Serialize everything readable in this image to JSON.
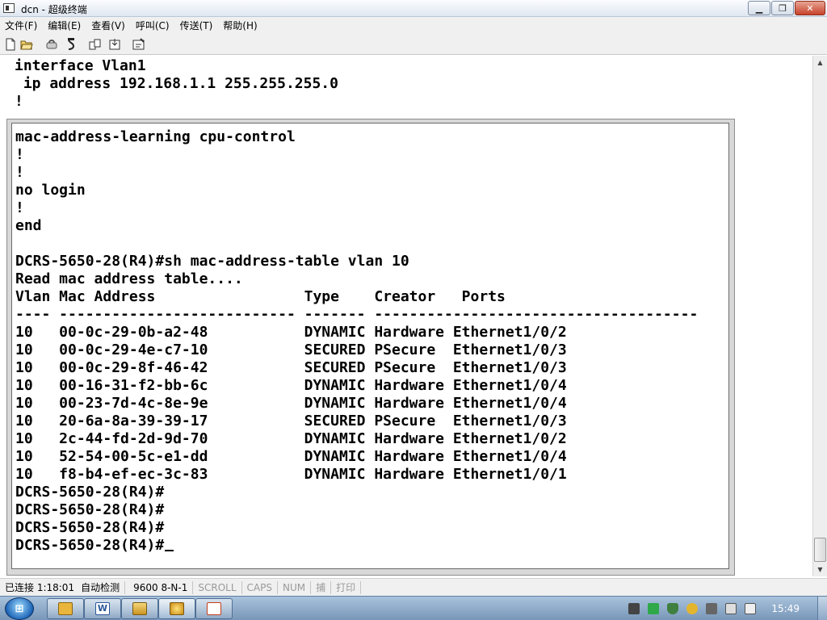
{
  "window": {
    "title": "dcn - 超级终端",
    "controls": {
      "minimize": "▁",
      "maximize": "❐",
      "close": "✕"
    }
  },
  "menu": [
    "文件(F)",
    "编辑(E)",
    "查看(V)",
    "呼叫(C)",
    "传送(T)",
    "帮助(H)"
  ],
  "toolbar": [
    "new-icon",
    "open-icon",
    "connect-icon",
    "disconnect-icon",
    "send-icon",
    "receive-icon",
    "properties-icon"
  ],
  "terminal": {
    "background_lines": [
      "interface Vlan1",
      " ip address 192.168.1.1 255.255.255.0",
      "!"
    ],
    "lines": [
      "mac-address-learning cpu-control",
      "!",
      "!",
      "no login",
      "!",
      "end",
      "",
      "DCRS-5650-28(R4)#sh mac-address-table vlan 10",
      "Read mac address table....",
      "Vlan Mac Address                 Type    Creator   Ports",
      "---- --------------------------- ------- -------------------------------------",
      "10   00-0c-29-0b-a2-48           DYNAMIC Hardware Ethernet1/0/2",
      "10   00-0c-29-4e-c7-10           SECURED PSecure  Ethernet1/0/3",
      "10   00-0c-29-8f-46-42           SECURED PSecure  Ethernet1/0/3",
      "10   00-16-31-f2-bb-6c           DYNAMIC Hardware Ethernet1/0/4",
      "10   00-23-7d-4c-8e-9e           DYNAMIC Hardware Ethernet1/0/4",
      "10   20-6a-8a-39-39-17           SECURED PSecure  Ethernet1/0/3",
      "10   2c-44-fd-2d-9d-70           DYNAMIC Hardware Ethernet1/0/2",
      "10   52-54-00-5c-e1-dd           DYNAMIC Hardware Ethernet1/0/4",
      "10   f8-b4-ef-ec-3c-83           DYNAMIC Hardware Ethernet1/0/1",
      "DCRS-5650-28(R4)#",
      "DCRS-5650-28(R4)#",
      "DCRS-5650-28(R4)#"
    ],
    "prompt": "DCRS-5650-28(R4)#"
  },
  "statusbar": {
    "connection": "已连接 1:18:01",
    "detect": "自动检测",
    "baud": "9600 8-N-1",
    "scroll": "SCROLL",
    "caps": "CAPS",
    "num": "NUM",
    "capture": "捕",
    "print": "打印"
  },
  "taskbar": {
    "clock": "15:49",
    "start_label": "⊞",
    "buttons": [
      "folder-icon",
      "word-icon",
      "explorer-icon",
      "hyperterminal-icon",
      "powerpoint-icon"
    ]
  },
  "colors": {
    "terminal_bg": "#ffffff",
    "terminal_fg": "#000000",
    "dialog_frame": "#d8d8d8",
    "taskbar": "#7896b8"
  }
}
